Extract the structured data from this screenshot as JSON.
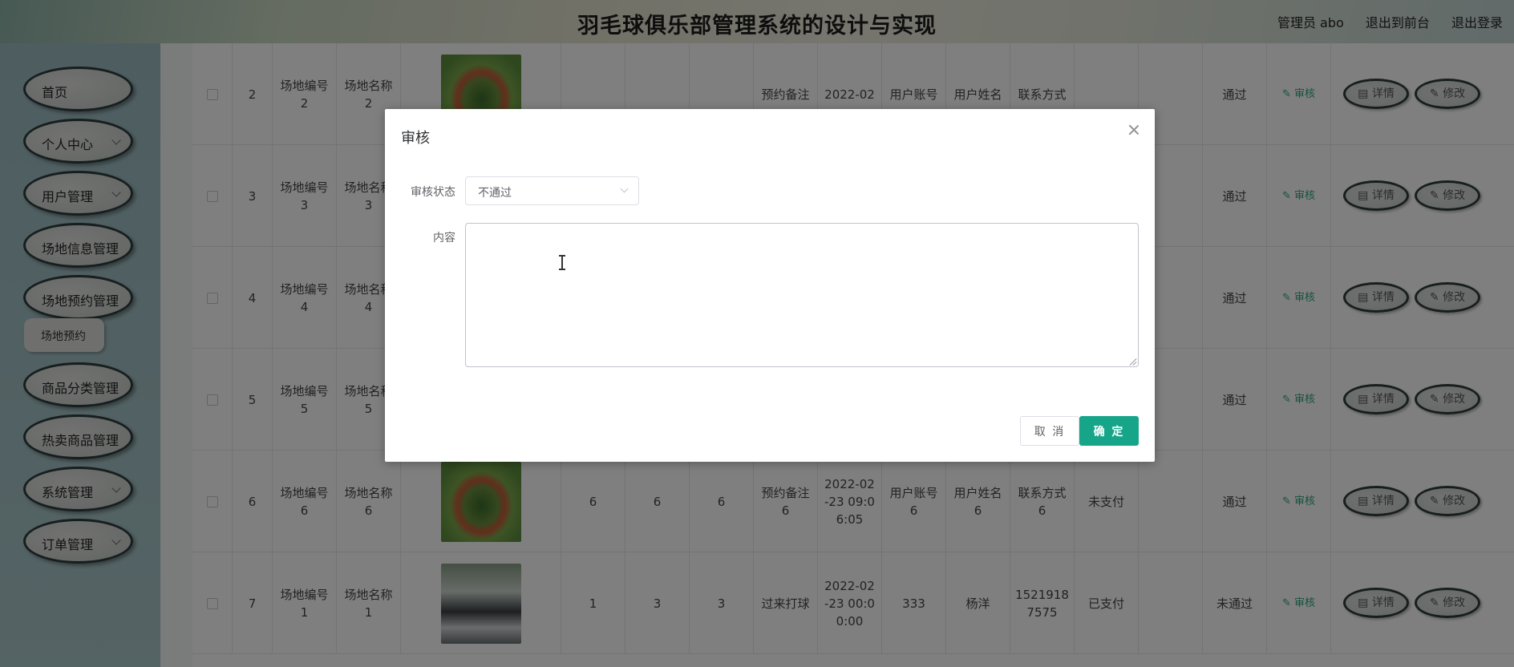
{
  "header": {
    "title": "羽毛球俱乐部管理系统的设计与实现",
    "admin_label": "管理员 abo",
    "front_link": "退出到前台",
    "logout_link": "退出登录"
  },
  "sidebar": {
    "items": [
      {
        "label": "首页",
        "has_children": false
      },
      {
        "label": "个人中心",
        "has_children": true
      },
      {
        "label": "用户管理",
        "has_children": true
      },
      {
        "label": "场地信息管理",
        "has_children": false
      },
      {
        "label": "场地预约管理",
        "has_children": false
      },
      {
        "label": "商品分类管理",
        "has_children": false
      },
      {
        "label": "热卖商品管理",
        "has_children": false
      },
      {
        "label": "系统管理",
        "has_children": true
      },
      {
        "label": "订单管理",
        "has_children": true
      }
    ],
    "submenu_label": "场地预约"
  },
  "table": {
    "rows": [
      {
        "index": "2",
        "venue_no": "场地编号\n2",
        "venue_name": "场地名称\n2",
        "thumb": "badminton-circle-photo",
        "n1": "",
        "n2": "",
        "n3": "",
        "note": "预约备注",
        "time": "2022-02",
        "account": "用户账号",
        "name": "用户姓名",
        "contact": "联系方式",
        "pay": "",
        "status": "通过"
      },
      {
        "index": "3",
        "venue_no": "场地编号\n3",
        "venue_name": "场地名称\n3",
        "thumb": "",
        "n1": "",
        "n2": "",
        "n3": "",
        "note": "",
        "time": "",
        "account": "",
        "name": "",
        "contact": "",
        "pay": "",
        "status": "通过"
      },
      {
        "index": "4",
        "venue_no": "场地编号\n4",
        "venue_name": "场地名称\n4",
        "thumb": "",
        "n1": "",
        "n2": "",
        "n3": "",
        "note": "",
        "time": "",
        "account": "",
        "name": "",
        "contact": "",
        "pay": "",
        "status": "通过"
      },
      {
        "index": "5",
        "venue_no": "场地编号\n5",
        "venue_name": "场地名称\n5",
        "thumb": "",
        "n1": "",
        "n2": "",
        "n3": "",
        "note": "",
        "time": "",
        "account": "",
        "name": "",
        "contact": "",
        "pay": "",
        "status": "通过"
      },
      {
        "index": "6",
        "venue_no": "场地编号\n6",
        "venue_name": "场地名称\n6",
        "thumb": "badminton-circle-photo",
        "n1": "6",
        "n2": "6",
        "n3": "6",
        "note": "预约备注\n6",
        "time": "2022-02\n-23 09:0\n6:05",
        "account": "用户账号\n6",
        "name": "用户姓名\n6",
        "contact": "联系方式\n6",
        "pay": "未支付",
        "status": "通过"
      },
      {
        "index": "7",
        "venue_no": "场地编号\n1",
        "venue_name": "场地名称\n1",
        "thumb": "group-photo",
        "n1": "1",
        "n2": "3",
        "n3": "3",
        "note": "过来打球",
        "time": "2022-02\n-23 00:0\n0:00",
        "account": "333",
        "name": "杨洋",
        "contact": "1521918\n7575",
        "pay": "已支付",
        "status": "未通过"
      }
    ],
    "op_review": "审核",
    "op_detail": "详情",
    "op_edit": "修改"
  },
  "dialog": {
    "title": "审核",
    "status_label": "审核状态",
    "status_value": "不通过",
    "content_label": "内容",
    "content_value": "",
    "cancel_label": "取 消",
    "confirm_label": "确 定"
  },
  "colors": {
    "accent": "#17a589",
    "review_link": "#2aa57c"
  }
}
